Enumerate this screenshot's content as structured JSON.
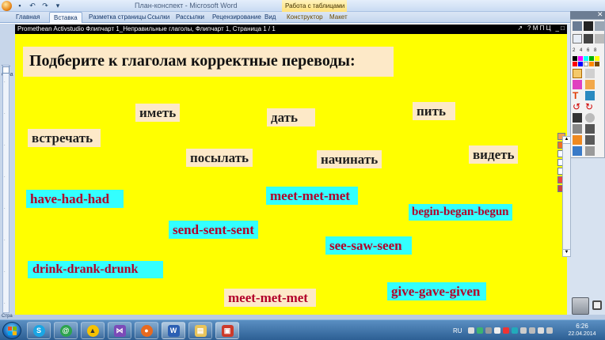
{
  "word": {
    "title": "План-конспект - Microsoft Word",
    "contextual_tab_title": "Работа с таблицами",
    "tabs": [
      "Главная",
      "Вставка",
      "Разметка страницы",
      "Ссылки",
      "Рассылки",
      "Рецензирование",
      "Вид",
      "Конструктор",
      "Макет"
    ],
    "active_tab_index": 1,
    "left_label": "Тит стра",
    "status_text": "Стра"
  },
  "flipchart": {
    "header_title": "Promethean Activstudio   Флипчарт 1_Неправильные глаголы,  Флипчарт 1,  Страница 1 / 1",
    "header_controls": [
      "↗",
      "? М П Ц",
      "_ □"
    ],
    "instruction": "Подберите  к глаголам  корректные  переводы:",
    "russian_words": [
      "иметь",
      "дать",
      "пить",
      "встречать",
      "посылать",
      "начинать",
      "видеть"
    ],
    "english_forms": [
      "have-had-had",
      "meet-met-met",
      "begin-began-begun",
      "send-sent-sent",
      "see-saw-seen",
      "drink-drank-drunk",
      "give-gave-given",
      "meet-met-met"
    ],
    "colors": {
      "canvas": "#ffff00",
      "russian_box": "#fde9c8",
      "english_box": "#33ffff",
      "english_text": "#b2002a"
    }
  },
  "toolbox": {
    "numbers": "2 4 6 8",
    "tools": [
      "pointer-icon",
      "pen-icon",
      "highlighter-icon",
      "eraser-icon",
      "text-icon",
      "fill-icon",
      "undo-icon",
      "redo-icon",
      "camera-icon",
      "clock-icon",
      "magnifier-icon",
      "shapes-icon"
    ]
  },
  "taskbar": {
    "language": "RU",
    "time": "6:26",
    "date": "22.04.2014",
    "apps": [
      "skype-icon",
      "mail-icon",
      "activinspire-icon",
      "visual-studio-icon",
      "firefox-icon",
      "word-icon",
      "explorer-icon",
      "activstudio-icon"
    ]
  }
}
